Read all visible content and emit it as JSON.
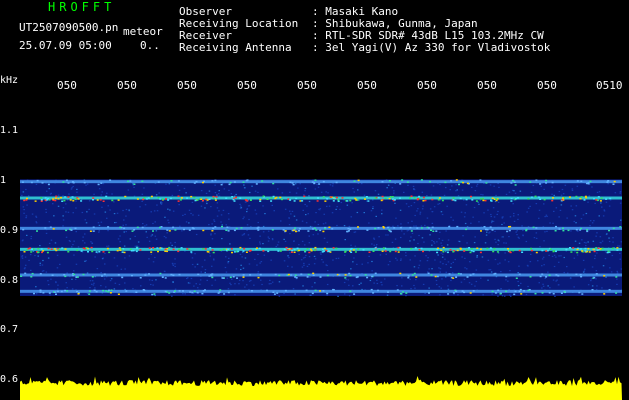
{
  "header": {
    "brand": "HROFFT",
    "filename": "UT2507090500.pn",
    "mode": "meteor",
    "datetime": "25.07.09 05:00",
    "counter": "0..",
    "info": [
      {
        "label": "Observer",
        "value": ": Masaki Kano"
      },
      {
        "label": "Receiving Location",
        "value": ": Shibukawa, Gunma, Japan"
      },
      {
        "label": "Receiver",
        "value": ": RTL-SDR SDR# 43dB L15 103.2MHz CW"
      },
      {
        "label": "Receiving Antenna",
        "value": ": 3el Yagi(V) Az 330 for Vladivostok"
      }
    ]
  },
  "chart_data": {
    "type": "heatmap",
    "ylabel": "kHz",
    "ylim": [
      0.6,
      1.2
    ],
    "y_ticks": [
      "1.1",
      "1",
      "0.9",
      "0.8",
      "0.7",
      "0.6"
    ],
    "x_ticks": [
      "050",
      "050",
      "050",
      "050",
      "050",
      "050",
      "050",
      "050",
      "050",
      "0510"
    ],
    "bands_khz": [
      {
        "freq": 1.025,
        "strength": 0.35
      },
      {
        "freq": 0.99,
        "strength": 0.85
      },
      {
        "freq": 0.925,
        "strength": 0.5
      },
      {
        "freq": 0.88,
        "strength": 1.0
      },
      {
        "freq": 0.825,
        "strength": 0.45
      },
      {
        "freq": 0.79,
        "strength": 0.45
      }
    ],
    "noise_floor_band_khz": [
      0.78,
      1.03
    ],
    "level_trace_color": "#ffff00"
  },
  "colors": {
    "background": "#000000",
    "text": "#ffffff",
    "brand": "#00ff00",
    "noise": "#0a1a7a",
    "trace": "#ffff00"
  }
}
